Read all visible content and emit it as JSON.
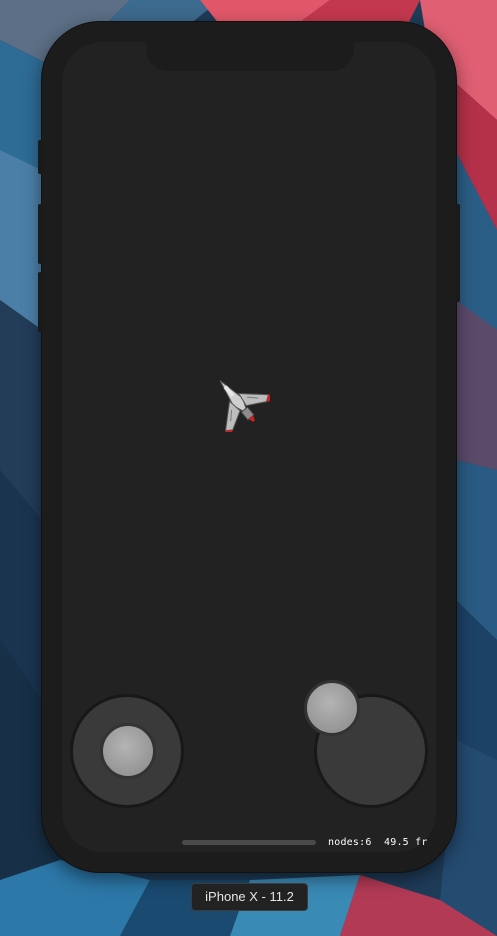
{
  "simulator": {
    "device_label": "iPhone X - 11.2"
  },
  "game": {
    "stats_nodes": "nodes:6",
    "stats_fps": "49.5 fr"
  },
  "colors": {
    "screen_background": "#222222",
    "phone_body": "#1c1c1c",
    "joystick_base": "#3a3a3a",
    "joystick_knob": "#a8a8a8",
    "ship_accent": "#d02020"
  }
}
